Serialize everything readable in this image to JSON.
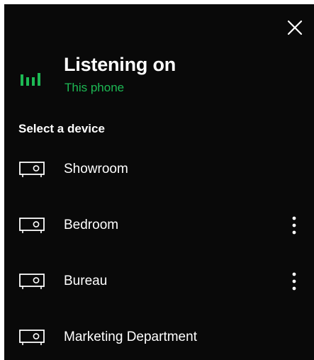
{
  "colors": {
    "panel_background": "#090909",
    "text": "#ffffff",
    "accent": "#1db954"
  },
  "header": {
    "title": "Listening on",
    "subtitle": "This phone",
    "now_playing_icon": "equalizer-bars-icon",
    "close_icon": "close-icon"
  },
  "devices_section": {
    "heading": "Select a device",
    "items": [
      {
        "label": "Showroom",
        "icon": "speaker-device-icon",
        "has_more_menu": false
      },
      {
        "label": "Bedroom",
        "icon": "speaker-device-icon",
        "has_more_menu": true
      },
      {
        "label": "Bureau",
        "icon": "speaker-device-icon",
        "has_more_menu": true
      },
      {
        "label": "Marketing Department",
        "icon": "speaker-device-icon",
        "has_more_menu": false
      }
    ]
  }
}
